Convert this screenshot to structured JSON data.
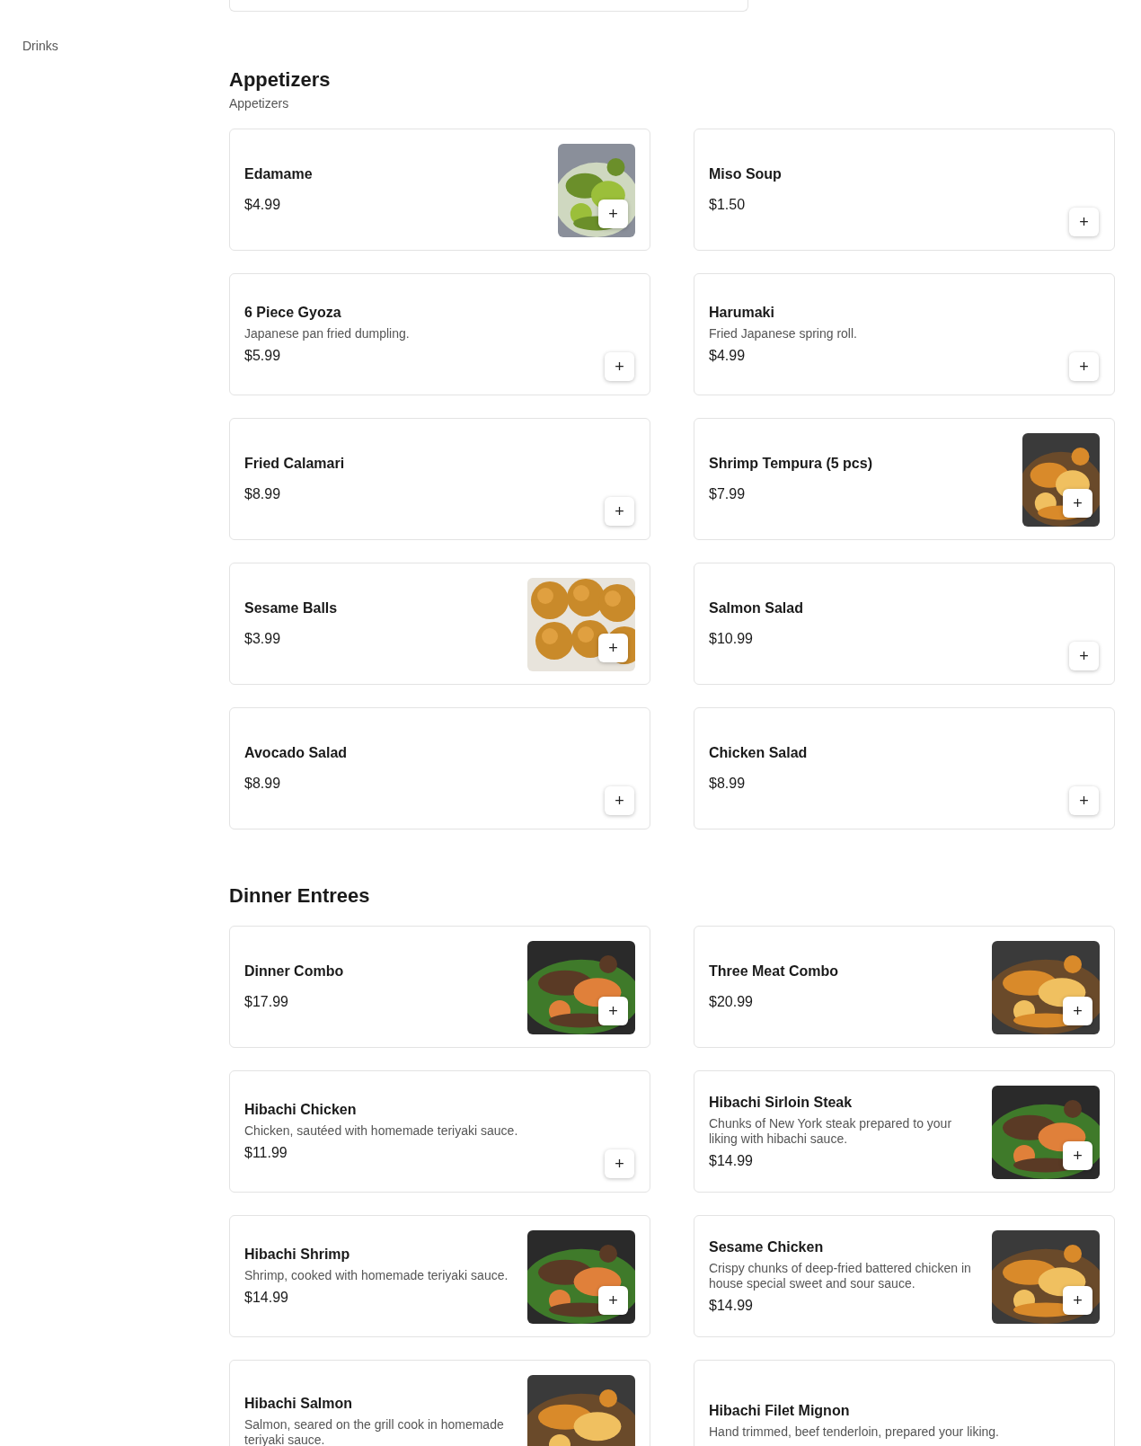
{
  "sidebar": {
    "items": [
      {
        "label": "Drinks"
      }
    ]
  },
  "sections": [
    {
      "title": "Appetizers",
      "subtitle": "Appetizers",
      "items": [
        {
          "name": "Edamame",
          "price": "$4.99",
          "add": "+"
        },
        {
          "name": "Miso Soup",
          "price": "$1.50",
          "add": "+"
        },
        {
          "name": "6 Piece Gyoza",
          "description": "Japanese pan fried dumpling.",
          "price": "$5.99",
          "add": "+"
        },
        {
          "name": "Harumaki",
          "description": "Fried Japanese spring roll.",
          "price": "$4.99",
          "add": "+"
        },
        {
          "name": "Fried Calamari",
          "price": "$8.99",
          "add": "+"
        },
        {
          "name": "Shrimp Tempura (5 pcs)",
          "price": "$7.99",
          "add": "+"
        },
        {
          "name": "Sesame Balls",
          "price": "$3.99",
          "add": "+"
        },
        {
          "name": "Salmon Salad",
          "price": "$10.99",
          "add": "+"
        },
        {
          "name": "Avocado Salad",
          "price": "$8.99",
          "add": "+"
        },
        {
          "name": "Chicken Salad",
          "price": "$8.99",
          "add": "+"
        }
      ]
    },
    {
      "title": "Dinner Entrees",
      "items": [
        {
          "name": "Dinner Combo",
          "price": "$17.99",
          "add": "+"
        },
        {
          "name": "Three Meat Combo",
          "price": "$20.99",
          "add": "+"
        },
        {
          "name": "Hibachi Chicken",
          "description": "Chicken, sautéed with homemade teriyaki sauce.",
          "price": "$11.99",
          "add": "+"
        },
        {
          "name": "Hibachi Sirloin Steak",
          "description": "Chunks of New York steak prepared to your liking with hibachi sauce.",
          "price": "$14.99",
          "add": "+"
        },
        {
          "name": "Hibachi Shrimp",
          "description": "Shrimp, cooked with homemade teriyaki sauce.",
          "price": "$14.99",
          "add": "+"
        },
        {
          "name": "Sesame Chicken",
          "description": "Crispy chunks of deep-fried battered chicken in house special sweet and sour sauce.",
          "price": "$14.99",
          "add": "+"
        },
        {
          "name": "Hibachi Salmon",
          "description": "Salmon, seared on the grill cook in homemade teriyaki sauce."
        },
        {
          "name": "Hibachi Filet Mignon",
          "description": "Hand trimmed, beef tenderloin, prepared your liking."
        }
      ]
    }
  ]
}
